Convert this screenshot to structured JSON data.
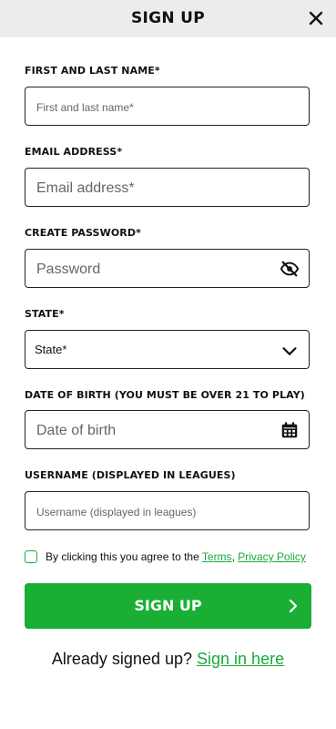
{
  "header": {
    "title": "SIGN UP",
    "close_icon": "close-icon"
  },
  "fields": {
    "name": {
      "label": "FIRST AND LAST NAME*",
      "placeholder": "First and last name*",
      "value": ""
    },
    "email": {
      "label": "EMAIL ADDRESS*",
      "placeholder": "Email address*",
      "value": ""
    },
    "password": {
      "label": "CREATE PASSWORD*",
      "placeholder": "Password",
      "value": "",
      "icon": "eye-off-icon"
    },
    "state": {
      "label": "STATE*",
      "selected": "State*",
      "icon": "chevron-down-icon"
    },
    "dob": {
      "label": "DATE OF BIRTH (YOU MUST BE OVER 21 TO PLAY)",
      "placeholder": "Date of birth",
      "value": "",
      "icon": "calendar-icon"
    },
    "username": {
      "label": "USERNAME (DISPLAYED IN LEAGUES)",
      "placeholder": "Username (displayed in leagues)",
      "value": ""
    }
  },
  "consent": {
    "text": "By clicking this you agree to the",
    "terms": "Terms",
    "separator": ",",
    "privacy": "Privacy Policy",
    "checked": false
  },
  "signup_button": {
    "label": "SIGN UP",
    "icon": "chevron-right-icon"
  },
  "signin": {
    "prompt": "Already signed up?",
    "link": "Sign in here"
  },
  "colors": {
    "accent": "#1aae35",
    "header_bg": "#ececec",
    "border": "#222222"
  }
}
